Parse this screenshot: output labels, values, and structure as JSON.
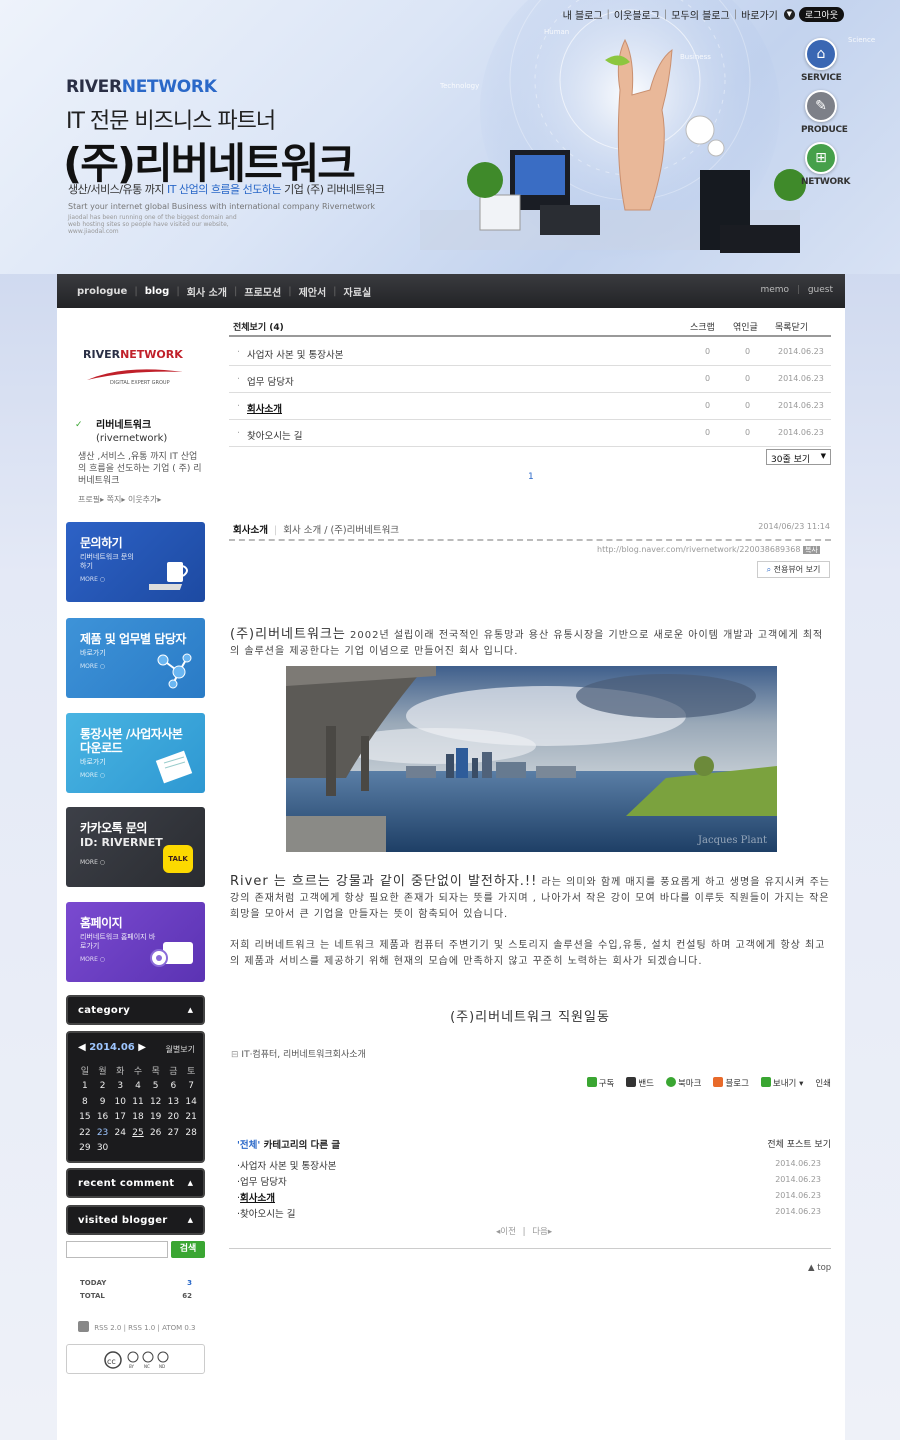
{
  "header": {
    "top_nav": [
      "내 블로그",
      "이웃블로그",
      "모두의 블로그",
      "바로가기"
    ],
    "logout_label": "로그아웃",
    "brand_river": "RIVER",
    "brand_network": "NETWORK",
    "tagline": "IT 전문 비즈니스 파트너",
    "company": "(주)리버네트워크",
    "subline_a": "생산/서비스/유통 까지",
    "subline_hl": "IT 산업의 흐름을 선도하는",
    "subline_b": "기업 (주) 리버네트워크",
    "english": "Start your internet global Business with international company Rivernetwork",
    "english_small": "Jiaodal has been running one of the biggest domain and web hosting sites so people have visited our website, www.jiaodal.com",
    "tech_labels": [
      "Human",
      "Technology",
      "Business",
      "Science"
    ],
    "side_icons": [
      {
        "label": "SERVICE",
        "color": "#3a67b3"
      },
      {
        "label": "PRODUCE",
        "color": "#7d8088"
      },
      {
        "label": "NETWORK",
        "color": "#46a04a"
      }
    ]
  },
  "menu": {
    "items": [
      "prologue",
      "blog",
      "회사 소개",
      "프로모션",
      "제안서",
      "자료실"
    ],
    "active": "blog",
    "right": [
      "memo",
      "guest"
    ]
  },
  "profile": {
    "logo_river": "RIVER",
    "logo_network": "NETWORK",
    "logo_sub": "DIGITAL EXPERT GROUP",
    "name": "리버네트워크",
    "id": "(rivernetwork)",
    "description": "생산 ,서비스 ,유통 까지 IT 산업의 흐름을 선도하는 기업 ( 주) 리버네트워크",
    "links": [
      "프로필",
      "쪽지",
      "이웃추가"
    ]
  },
  "banners": [
    {
      "title": "문의하기",
      "sub": "리버네트워크 문의하기",
      "more": "MORE"
    },
    {
      "title": "제품 및 업무별 담당자",
      "sub": "바로가기",
      "more": "MORE"
    },
    {
      "title": "통장사본 /사업자사본 다운로드",
      "sub": "바로가기",
      "more": "MORE"
    },
    {
      "title": "카카오톡 문의",
      "sub": "ID: RIVERNET",
      "more": "MORE",
      "badge": "TALK"
    },
    {
      "title": "홈페이지",
      "sub": "리버네트워크 홈페이지 바로가기",
      "more": "MORE"
    }
  ],
  "widgets": {
    "category": "category",
    "recent_comment": "recent comment",
    "visited_blogger": "visited blogger"
  },
  "calendar": {
    "year_month": "2014.06",
    "weekly_view": "월별보기",
    "weekdays": [
      "일",
      "월",
      "화",
      "수",
      "목",
      "금",
      "토"
    ],
    "weeks": [
      [
        "1",
        "2",
        "3",
        "4",
        "5",
        "6",
        "7"
      ],
      [
        "8",
        "9",
        "10",
        "11",
        "12",
        "13",
        "14"
      ],
      [
        "15",
        "16",
        "17",
        "18",
        "19",
        "20",
        "21"
      ],
      [
        "22",
        "23",
        "24",
        "25",
        "26",
        "27",
        "28"
      ],
      [
        "29",
        "30",
        "",
        "",
        "",
        "",
        ""
      ]
    ],
    "highlight": "23",
    "underlined": "25"
  },
  "search": {
    "button": "검색",
    "placeholder": ""
  },
  "stats": {
    "today_label": "TODAY",
    "today": "3",
    "total_label": "TOTAL",
    "total": "62"
  },
  "rss": [
    "RSS 2.0",
    "RSS 1.0",
    "ATOM 0.3"
  ],
  "cc": [
    "BY",
    "NC",
    "ND"
  ],
  "post_list": {
    "all_label": "전체보기 (4)",
    "col_scrap": "스크랩",
    "col_link": "엮인글",
    "col_date": "목록닫기",
    "rows": [
      {
        "title": "사업자 사본 및 통장사본",
        "scrap": "0",
        "link": "0",
        "date": "2014.06.23"
      },
      {
        "title": "업무 담당자",
        "scrap": "0",
        "link": "0",
        "date": "2014.06.23"
      },
      {
        "title": "회사소개",
        "scrap": "0",
        "link": "0",
        "date": "2014.06.23",
        "current": true
      },
      {
        "title": "찾아오시는 길",
        "scrap": "0",
        "link": "0",
        "date": "2014.06.23"
      }
    ],
    "per_page": "30줄 보기",
    "page": "1"
  },
  "post": {
    "title": "회사소개",
    "category": "회사 소개 / (주)리버네트워크",
    "datetime": "2014/06/23 11:14",
    "url": "http://blog.naver.com/rivernetwork/220038689368",
    "copy_label": "복사",
    "viewer_btn": "전용뷰어 보기",
    "para1_big": "(주)리버네트워크는",
    "para1": " 2002년 설립이래 전국적인 유통망과 용산 유통시장을 기반으로 새로운 아이템 개발과 고객에게 최적의 솔루션을 제공한다는 기업 이념으로 만들어진 회사 입니다.",
    "para2_big": "River 는 흐르는 강물과 같이 중단없이 발전하자.!!",
    "para2": " 라는 의미와 함께 매지를 풍요롭게 하고 생명을 유지시켜 주는 강의 존재처럼 고객에게 항상 필요한 존재가 되자는 뜻를 가지며 , 나아가서 작은 강이 모여 바다를 이루듯 직원들이 가지는 작은 희망을 모아서 큰 기업을 만들자는 뜻이 함축되어 있습니다.",
    "para3": "저희 리버네트워크 는 네트워크 제품과 컴퓨터 주변기기 및 스토리지 솔루션을 수입,유통, 설치 컨설팅 하며  고객에게 항상 최고의 제품과 서비스를 제공하기 위해 현재의 모습에 만족하지 않고 꾸준히 노력하는 회사가 되겠습니다.",
    "signature": "(주)리버네트워크 직원일동",
    "tags": "IT·컴퓨터, 리버네트워크회사소개",
    "photo_watermark": "Jacques Plant",
    "actions": [
      "구독",
      "밴드",
      "북마크",
      "블로그",
      "보내기",
      "인쇄"
    ]
  },
  "other": {
    "cat": "'전체'",
    "suffix": "카테고리의 다른 글",
    "all": "전체 포스트 보기",
    "rows": [
      {
        "title": "사업자 사본 및 통장사본",
        "date": "2014.06.23"
      },
      {
        "title": "업무 담당자",
        "date": "2014.06.23"
      },
      {
        "title": "회사소개",
        "date": "2014.06.23",
        "current": true
      },
      {
        "title": "찾아오시는 길",
        "date": "2014.06.23"
      }
    ],
    "prev": "이전",
    "next": "다음",
    "top": "top"
  }
}
